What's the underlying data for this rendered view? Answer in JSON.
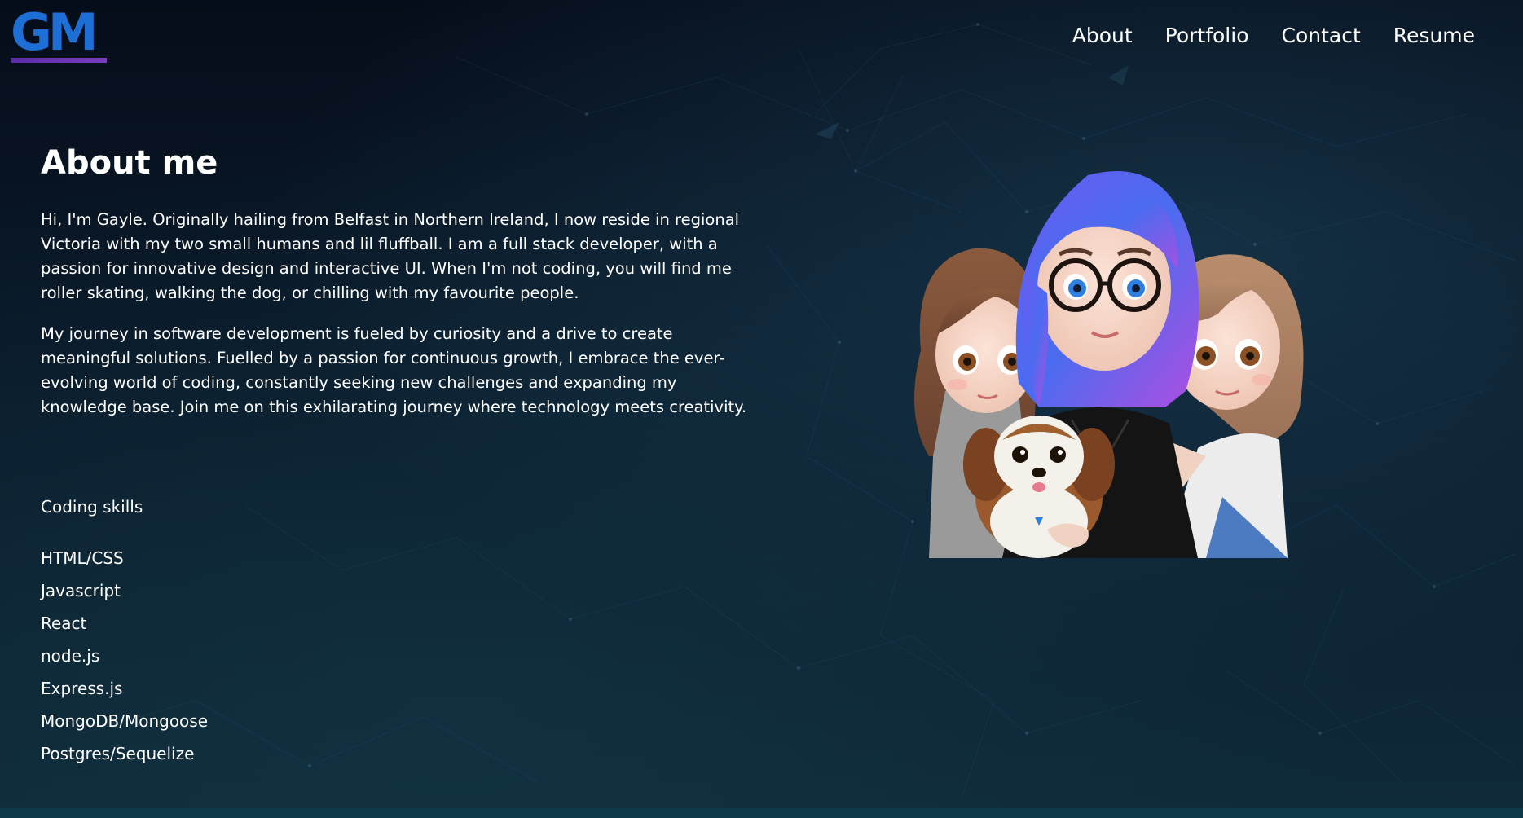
{
  "header": {
    "logo": "GM",
    "nav": [
      "About",
      "Portfolio",
      "Contact",
      "Resume"
    ]
  },
  "about": {
    "title": "About me",
    "paragraphs": [
      "Hi, I'm Gayle. Originally hailing from Belfast in Northern Ireland, I now reside in regional Victoria with my two small humans and lil fluffball. I am a full stack developer, with a passion for innovative design and interactive UI. When I'm not coding, you will find me roller skating, walking the dog, or chilling with my favourite people.",
      "My journey in software development is fueled by curiosity and a drive to create meaningful solutions. Fuelled by a passion for continuous growth, I embrace the ever-evolving world of coding, constantly seeking new challenges and expanding my knowledge base. Join me on this exhilarating journey where technology meets creativity."
    ]
  },
  "skills": {
    "heading": "Coding skills",
    "items": [
      "HTML/CSS",
      "Javascript",
      "React",
      "node.js",
      "Express.js",
      "MongoDB/Mongoose",
      "Postgres/Sequelize"
    ]
  },
  "colors": {
    "logo_blue": "#1d6fd6",
    "logo_underline": "#5b2ca8",
    "background_top": "#060d1a",
    "background_bottom": "#0f2a3a"
  }
}
